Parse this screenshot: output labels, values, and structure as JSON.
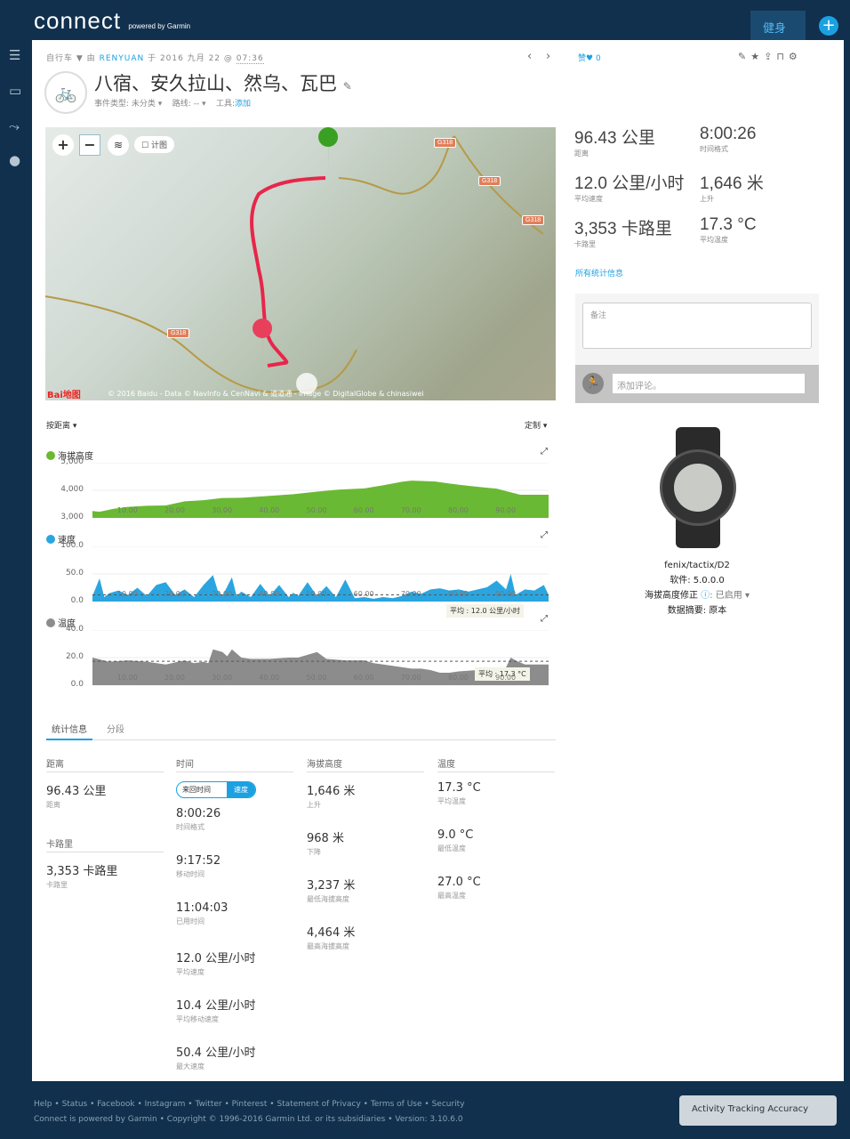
{
  "header": {
    "logo": "connect",
    "logo_sub": "powered by Garmin",
    "fitness_label": "健身",
    "add_icon": "plus-icon"
  },
  "sidebar": {
    "icons": [
      "menu-icon",
      "inbox-icon",
      "segments-icon",
      "user-icon"
    ]
  },
  "activity": {
    "type": "自行车",
    "by": "由",
    "user": "RENYUAN",
    "at": "于 2016 九月 22 @",
    "time": "07:36",
    "title": "八宿、安久拉山、然乌、瓦巴",
    "event_type": "事件类型: 未分类 ▾",
    "route": "路线: -- ▾",
    "gear_label": "工具:",
    "gear_add": "添加",
    "like_label": "赞",
    "like_count": "0"
  },
  "map": {
    "layer_checkbox": "计图",
    "copyright": "© 2016 Baidu - Data © NavInfo & CenNavi & 道道通 - Image © DigitalGlobe & chinasiwei",
    "road_label": "G318",
    "baidu": "Bai地图"
  },
  "chart_controls": {
    "x_axis": "按距离 ▾",
    "customize": "定制 ▾"
  },
  "summary": [
    {
      "value": "96.43 公里",
      "label": "距离"
    },
    {
      "value": "8:00:26",
      "label": "时间格式"
    },
    {
      "value": "12.0 公里/小时",
      "label": "平均速度"
    },
    {
      "value": "1,646 米",
      "label": "上升"
    },
    {
      "value": "3,353 卡路里",
      "label": "卡路里"
    },
    {
      "value": "17.3 °C",
      "label": "平均温度"
    }
  ],
  "all_stats_link": "所有统计信息",
  "notes_placeholder": "备注",
  "comment_placeholder": "添加评论。",
  "device": {
    "name": "fenix/tactix/D2",
    "software": "软件: 5.0.0.0",
    "elev_corr": "海拔高度修正",
    "elev_corr_val": ": 已启用 ▾",
    "data_summary": "数据摘要: 原本"
  },
  "chart_data": [
    {
      "type": "area",
      "title": "海拔高度",
      "color": "#6ab934",
      "ylim": [
        3000,
        5000
      ],
      "yticks": [
        "5,000",
        "4,000",
        "3,000"
      ],
      "xlim": [
        2.5,
        99
      ],
      "xticks": [
        "10.00",
        "20.00",
        "30.00",
        "40.00",
        "50.00",
        "60.00",
        "70.00",
        "80.00",
        "90.00"
      ],
      "x": [
        2.5,
        4,
        7,
        10,
        14,
        18,
        22,
        26,
        30,
        34,
        40,
        45,
        50,
        55,
        60,
        64,
        68,
        70,
        72,
        75,
        80,
        85,
        88,
        90,
        93,
        99
      ],
      "y": [
        3250,
        3220,
        3330,
        3400,
        3440,
        3450,
        3600,
        3640,
        3720,
        3730,
        3800,
        3860,
        3950,
        4030,
        4070,
        4180,
        4310,
        4350,
        4340,
        4320,
        4200,
        4110,
        4060,
        3970,
        3840,
        3840
      ]
    },
    {
      "type": "area",
      "title": "速度",
      "color": "#2aa5e0",
      "ylim": [
        0,
        100
      ],
      "yticks": [
        "100.0",
        "50.0",
        "0.0"
      ],
      "xlim": [
        2.5,
        99
      ],
      "avg_label": "平均 : 12.0 公里/小时",
      "avg": 12,
      "x": [
        2.5,
        4,
        5,
        6,
        8,
        10,
        12,
        14,
        16,
        18,
        20,
        22,
        24,
        26,
        28,
        29,
        30,
        32,
        33,
        34,
        36,
        38,
        40,
        42,
        44,
        45,
        46,
        48,
        50,
        52,
        54,
        56,
        58,
        60,
        62,
        64,
        66,
        68,
        70,
        72,
        74,
        76,
        78,
        80,
        82,
        84,
        86,
        88,
        90,
        91,
        92,
        94,
        96,
        98,
        99
      ],
      "y": [
        10,
        42,
        8,
        15,
        20,
        12,
        25,
        10,
        30,
        35,
        12,
        22,
        8,
        30,
        48,
        20,
        10,
        44,
        10,
        18,
        8,
        32,
        10,
        30,
        8,
        16,
        10,
        35,
        10,
        28,
        8,
        40,
        6,
        8,
        5,
        8,
        6,
        10,
        18,
        14,
        22,
        24,
        20,
        22,
        18,
        22,
        26,
        38,
        22,
        50,
        12,
        22,
        20,
        30,
        12
      ]
    },
    {
      "type": "area",
      "title": "温度",
      "color": "#8c8c8c",
      "ylim": [
        0,
        40
      ],
      "yticks": [
        "40.0",
        "20.0",
        "0.0"
      ],
      "xlim": [
        2.5,
        99
      ],
      "avg_label": "平均 : 17.3 °C",
      "avg": 17.3,
      "x": [
        2.5,
        6,
        10,
        14,
        18,
        22,
        24,
        26,
        27,
        28,
        30,
        31,
        32,
        34,
        36,
        40,
        44,
        46,
        48,
        50,
        52,
        56,
        60,
        62,
        66,
        70,
        72,
        74,
        76,
        78,
        80,
        84,
        88,
        90,
        91,
        92,
        94,
        96,
        99
      ],
      "y": [
        20,
        17,
        18,
        17,
        15,
        18,
        16,
        17,
        16,
        26,
        24,
        21,
        26,
        20,
        19,
        19,
        20,
        20,
        22,
        24,
        19,
        18,
        18,
        16,
        14,
        12,
        12,
        11,
        9,
        9,
        10,
        11,
        12,
        13,
        20,
        18,
        15,
        15,
        15
      ]
    }
  ],
  "tabs": [
    "统计信息",
    "分段"
  ],
  "stats_table": {
    "distance": {
      "header": "距离",
      "rows": [
        {
          "v": "96.43 公里",
          "l": "距离"
        }
      ]
    },
    "calories": {
      "header": "卡路里",
      "rows": [
        {
          "v": "3,353 卡路里",
          "l": "卡路里"
        }
      ]
    },
    "time": {
      "header": "时间",
      "toggle": [
        "来回时间",
        "速度"
      ],
      "rows": [
        {
          "v": "8:00:26",
          "l": "时间格式"
        },
        {
          "v": "9:17:52",
          "l": "移动时间"
        },
        {
          "v": "11:04:03",
          "l": "已用时间"
        },
        {
          "v": "12.0 公里/小时",
          "l": "平均速度"
        },
        {
          "v": "10.4 公里/小时",
          "l": "平均移动速度"
        },
        {
          "v": "50.4 公里/小时",
          "l": "最大速度"
        }
      ]
    },
    "elevation": {
      "header": "海拔高度",
      "rows": [
        {
          "v": "1,646 米",
          "l": "上升"
        },
        {
          "v": "968 米",
          "l": "下降"
        },
        {
          "v": "3,237 米",
          "l": "最低海拔高度"
        },
        {
          "v": "4,464 米",
          "l": "最高海拔高度"
        }
      ]
    },
    "temperature": {
      "header": "温度",
      "rows": [
        {
          "v": "17.3 °C",
          "l": "平均温度"
        },
        {
          "v": "9.0 °C",
          "l": "最低温度"
        },
        {
          "v": "27.0 °C",
          "l": "最高温度"
        }
      ]
    }
  },
  "footer": {
    "links": [
      "Help",
      "Status",
      "Facebook",
      "Instagram",
      "Twitter",
      "Pinterest",
      "Statement of Privacy",
      "Terms of Use",
      "Security"
    ],
    "copyright": "Connect is powered by Garmin • Copyright © 1996-2016 Garmin Ltd. or its subsidiaries • Version: 3.10.6.0",
    "tracking_button": "Activity Tracking Accuracy"
  }
}
